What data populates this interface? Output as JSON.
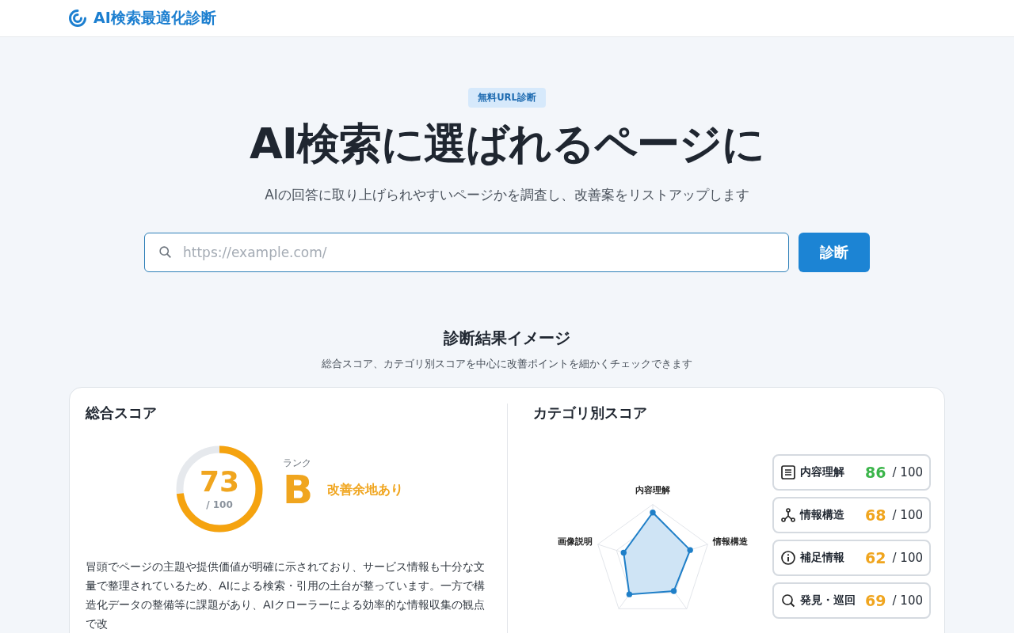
{
  "header": {
    "brand": "AI検索最適化診断"
  },
  "hero": {
    "badge": "無料URL診断",
    "title": "AI検索に選ばれるページに",
    "subtitle": "AIの回答に取り上げられやすいページかを調査し、改善案をリストアップします",
    "search": {
      "placeholder": "https://example.com/"
    },
    "button": "診断"
  },
  "preview": {
    "title": "診断結果イメージ",
    "subtitle": "総合スコア、カテゴリ別スコアを中心に改善ポイントを細かくチェックできます"
  },
  "overall": {
    "title": "総合スコア",
    "score": "73",
    "max": "/ 100",
    "level": 0.73,
    "rank_label": "ランク",
    "rank": "B",
    "rank_note": "改善余地あり",
    "summary": "冒頭でページの主題や提供価値が明確に示されており、サービス情報も十分な文量で整理されているため、AIによる検索・引用の土台が整っています。一方で構造化データの整備等に課題があり、AIクローラーによる効率的な情報収集の観点で改"
  },
  "categories": {
    "title": "カテゴリ別スコア",
    "radar_labels": [
      "内容理解",
      "情報構造",
      "画像説明"
    ],
    "items": [
      {
        "kind": "document",
        "name": "内容理解",
        "score": "86",
        "max": "/ 100",
        "color": "#3bb54a"
      },
      {
        "kind": "network",
        "name": "情報構造",
        "score": "68",
        "max": "/ 100",
        "color": "#f0a51e"
      },
      {
        "kind": "info",
        "name": "補足情報",
        "score": "62",
        "max": "/ 100",
        "color": "#f0a51e"
      },
      {
        "kind": "search",
        "name": "発見・巡回",
        "score": "69",
        "max": "/ 100",
        "color": "#f0a51e"
      }
    ]
  }
}
